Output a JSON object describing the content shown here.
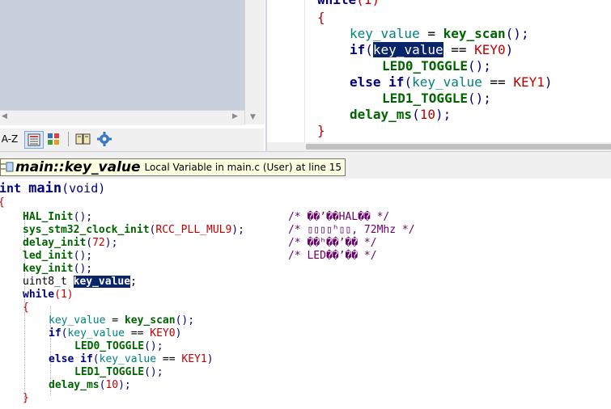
{
  "toolbar": {
    "sort_az": "A-Z"
  },
  "tooltip": {
    "symbol": "main::key_value",
    "description": "Local Variable in main.c (User) at line 15"
  },
  "editor_top": {
    "while_kw": "while",
    "while_arg": "(1)",
    "open_brace": "{",
    "close_brace": "}",
    "line1_var": "key_value",
    "line1_op": " = ",
    "line1_fn": "key_scan",
    "line1_tail": "();",
    "line2_if": "if",
    "line2_open": "(",
    "line2_sel": "key_value",
    "line2_op": " == ",
    "line2_mac": "KEY0",
    "line2_close": ")",
    "line3_fn": "LED0_TOGGLE",
    "line3_tail": "();",
    "line4_else": "else if",
    "line4_open": "(",
    "line4_var": "key_value",
    "line4_op": " == ",
    "line4_mac": "KEY1",
    "line4_close": ")",
    "line5_fn": "LED1_TOGGLE",
    "line5_tail": "();",
    "line6_fn": "delay_ms",
    "line6_open": "(",
    "line6_num": "10",
    "line6_tail": ");"
  },
  "editor_bottom": {
    "sig_type": "int",
    "sig_name": "main",
    "sig_args": "(void)",
    "open_brace": "{",
    "close_brace": "}",
    "hal_fn": "HAL_Init",
    "hal_tail": "();",
    "hal_cmt": "/* ��’��HAL�� */",
    "clk_fn": "sys_stm32_clock_init",
    "clk_open": "(",
    "clk_arg": "RCC_PLL_MUL9",
    "clk_tail": ");",
    "clk_cmt": "/* ▯▯▯▯ʰ▯▯, 72Mhz */",
    "delay_fn": "delay_init",
    "delay_open": "(",
    "delay_arg": "72",
    "delay_tail": ");",
    "delay_cmt": "/* ��ʰ��’�� */",
    "led_fn": "led_init",
    "led_tail": "();",
    "led_cmt": "/* LED��’�� */",
    "key_fn": "key_init",
    "key_tail": "();",
    "decl_type": "uint8_t ",
    "decl_sel": "key_value",
    "decl_end": ";",
    "while_kw": "while",
    "while_arg": "(1)",
    "inner_open": "{",
    "inner_close": "}",
    "l1_var": "key_value",
    "l1_op": " = ",
    "l1_fn": "key_scan",
    "l1_tail": "();",
    "l2_if": "if",
    "l2_open": "(",
    "l2_var": "key_value",
    "l2_op": " == ",
    "l2_mac": "KEY0",
    "l2_close": ")",
    "l3_fn": "LED0_TOGGLE",
    "l3_tail": "();",
    "l4_else": "else if",
    "l4_open": "(",
    "l4_var": "key_value",
    "l4_op": " == ",
    "l4_mac": "KEY1",
    "l4_close": ")",
    "l5_fn": "LED1_TOGGLE",
    "l5_tail": "();",
    "l6_fn": "delay_ms",
    "l6_open": "(",
    "l6_num": "10",
    "l6_tail": ");"
  }
}
